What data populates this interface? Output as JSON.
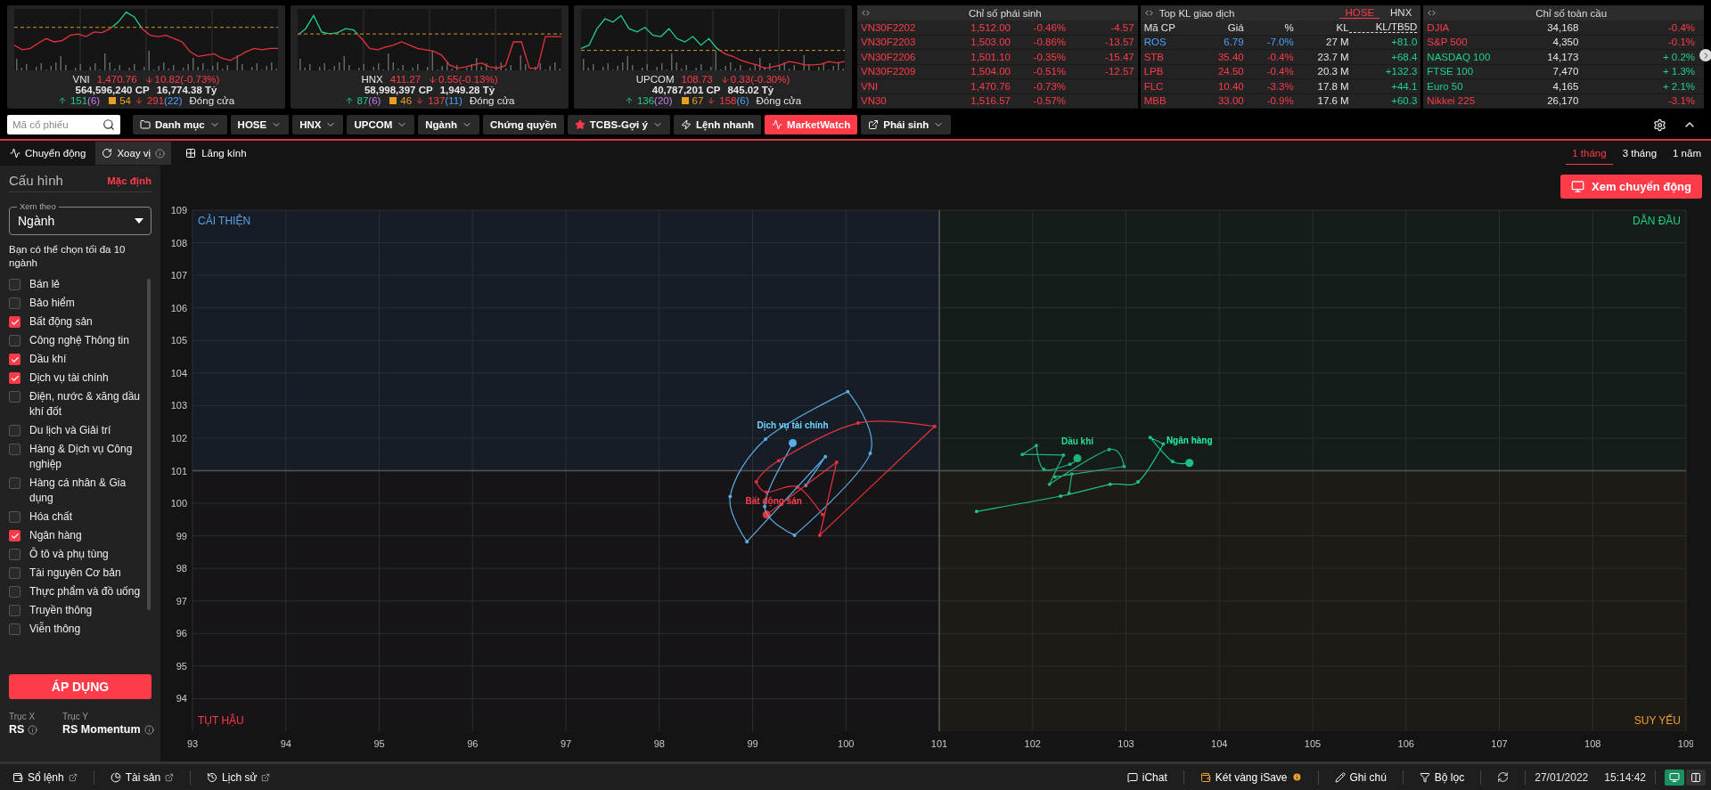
{
  "index_cards": [
    {
      "name": "VNI",
      "value": "1,470.76",
      "change": "10.82(-0.73%)",
      "volume": "564,596,240 CP",
      "turnover": "16,774.38 Tỷ",
      "advances": "151",
      "ceiling": "(6)",
      "unchanged": "54",
      "declines": "291",
      "floor": "(22)",
      "status": "Đóng cửa"
    },
    {
      "name": "HNX",
      "value": "411.27",
      "change": "0.55(-0.13%)",
      "volume": "58,998,397 CP",
      "turnover": "1,949.28 Tỷ",
      "advances": "87",
      "ceiling": "(6)",
      "unchanged": "46",
      "declines": "137",
      "floor": "(11)",
      "status": "Đóng cửa"
    },
    {
      "name": "UPCOM",
      "value": "108.73",
      "change": "0.33(-0.30%)",
      "volume": "40,787,201 CP",
      "turnover": "845.02 Tỷ",
      "advances": "136",
      "ceiling": "(20)",
      "unchanged": "67",
      "declines": "158",
      "floor": "(6)",
      "status": "Đóng cửa"
    }
  ],
  "derivatives": {
    "title": "Chỉ số phái sinh",
    "rows": [
      {
        "name": "VN30F2202",
        "price": "1,512.00",
        "pct": "-0.46%",
        "change": "-4.57"
      },
      {
        "name": "VN30F2203",
        "price": "1,503.00",
        "pct": "-0.86%",
        "change": "-13.57"
      },
      {
        "name": "VN30F2206",
        "price": "1,501.10",
        "pct": "-0.35%",
        "change": "-15.47"
      },
      {
        "name": "VN30F2209",
        "price": "1,504.00",
        "pct": "-0.51%",
        "change": "-12.57"
      },
      {
        "name": "VNI",
        "price": "1,470.76",
        "pct": "-0.73%"
      },
      {
        "name": "VN30",
        "price": "1,516.57",
        "pct": "-0.57%"
      }
    ]
  },
  "top_volume": {
    "title": "Top KL giao dịch",
    "tabs": [
      {
        "label": "HOSE",
        "selected": true
      },
      {
        "label": "HNX",
        "selected": false
      }
    ],
    "columns": [
      "Mã CP",
      "Giá",
      "%",
      "KL",
      "KL/TB5D"
    ],
    "rows": [
      {
        "code": "ROS",
        "price": "6.79",
        "pct": "-7.0%",
        "volume": "27 M",
        "ratio": "+81.0",
        "color": "#4aa3ff"
      },
      {
        "code": "STB",
        "price": "35.40",
        "pct": "-0.4%",
        "volume": "23.7 M",
        "ratio": "+68.4",
        "color": "#ff3b4a"
      },
      {
        "code": "LPB",
        "price": "24.50",
        "pct": "-0.4%",
        "volume": "20.3 M",
        "ratio": "+132.3",
        "color": "#ff3b4a"
      },
      {
        "code": "FLC",
        "price": "10.40",
        "pct": "-3.3%",
        "volume": "17.8 M",
        "ratio": "+44.1",
        "color": "#ff3b4a"
      },
      {
        "code": "MBB",
        "price": "33.00",
        "pct": "-0.9%",
        "volume": "17.6 M",
        "ratio": "+60.3",
        "color": "#ff3b4a"
      }
    ]
  },
  "global_indices": {
    "title": "Chỉ số toàn cầu",
    "rows": [
      {
        "name": "DJIA",
        "value": "34,168",
        "pct": "-0.4%",
        "color": "#ff3b4a"
      },
      {
        "name": "S&P 500",
        "value": "4,350",
        "pct": "-0.1%",
        "color": "#ff3b4a"
      },
      {
        "name": "NASDAQ 100",
        "value": "14,173",
        "pct": "+ 0.2%",
        "color": "#1fd18b"
      },
      {
        "name": "FTSE 100",
        "value": "7,470",
        "pct": "+ 1.3%",
        "color": "#1fd18b"
      },
      {
        "name": "Euro 50",
        "value": "4,165",
        "pct": "+ 2.1%",
        "color": "#1fd18b"
      },
      {
        "name": "Nikkei 225",
        "value": "26,170",
        "pct": "-3.1%",
        "color": "#ff3b4a"
      }
    ]
  },
  "toolbar": {
    "search": {
      "placeholder": "Mã cổ phiếu"
    },
    "items": [
      {
        "label": "Danh mục",
        "caret": true,
        "selected": false
      },
      {
        "label": "HOSE",
        "caret": true,
        "selected": false
      },
      {
        "label": "HNX",
        "caret": true,
        "selected": false
      },
      {
        "label": "UPCOM",
        "caret": true,
        "selected": false
      },
      {
        "label": "Ngành",
        "caret": true,
        "selected": false
      },
      {
        "label": "Chứng quyền",
        "caret": false,
        "selected": false
      },
      {
        "label": "TCBS-Gợi ý",
        "caret": true,
        "selected": false
      },
      {
        "label": "Lệnh nhanh",
        "caret": false,
        "selected": false
      },
      {
        "label": "MarketWatch",
        "caret": false,
        "selected": true
      },
      {
        "label": "Phái sinh",
        "caret": true,
        "selected": false
      }
    ]
  },
  "view_tabs": [
    {
      "label": "Chuyển động",
      "selected": false
    },
    {
      "label": "Xoay vị",
      "selected": true
    }
  ],
  "lens": "Lăng kính",
  "periods": [
    {
      "label": "1 tháng",
      "selected": true
    },
    {
      "label": "3 tháng",
      "selected": false
    },
    {
      "label": "1 năm",
      "selected": false
    }
  ],
  "sidebar": {
    "title": "Cấu hình",
    "reset": "Mặc định",
    "view_select": {
      "label": "Xem theo",
      "value": "Ngành"
    },
    "hint": "Bạn có thể chọn tối đa 10 ngành",
    "sectors": [
      {
        "label": "Bán lẻ",
        "checked": false
      },
      {
        "label": "Bảo hiểm",
        "checked": false
      },
      {
        "label": "Bất động sản",
        "checked": true
      },
      {
        "label": "Công nghệ Thông tin",
        "checked": false
      },
      {
        "label": "Dầu khí",
        "checked": true
      },
      {
        "label": "Dịch vụ tài chính",
        "checked": true
      },
      {
        "label": "Điện, nước & xăng dầu khí đốt",
        "checked": false
      },
      {
        "label": "Du lịch và Giải trí",
        "checked": false
      },
      {
        "label": "Hàng & Dịch vụ Công nghiệp",
        "checked": false
      },
      {
        "label": "Hàng cá nhân & Gia dụng",
        "checked": false
      },
      {
        "label": "Hóa chất",
        "checked": false
      },
      {
        "label": "Ngân hàng",
        "checked": true
      },
      {
        "label": "Ô tô và phụ tùng",
        "checked": false
      },
      {
        "label": "Tài nguyên Cơ bản",
        "checked": false
      },
      {
        "label": "Thực phẩm và đồ uống",
        "checked": false
      },
      {
        "label": "Truyền thông",
        "checked": false
      },
      {
        "label": "Viễn thông",
        "checked": false
      }
    ],
    "apply": "ÁP DỤNG",
    "axes": [
      {
        "label": "Trục X",
        "value": "RS"
      },
      {
        "label": "Trục Y",
        "value": "RS Momentum"
      }
    ]
  },
  "play_button": "Xem chuyển động",
  "rrg": {
    "chart_data": {
      "type": "line",
      "grid": true,
      "xlim": [
        93,
        109
      ],
      "ylim": [
        93,
        109
      ],
      "xticks": [
        93,
        94,
        95,
        96,
        97,
        98,
        99,
        100,
        101,
        102,
        103,
        104,
        105,
        106,
        107,
        108,
        109
      ],
      "yticks": [
        94,
        95,
        96,
        97,
        98,
        99,
        100,
        101,
        102,
        103,
        104,
        105,
        106,
        107,
        108,
        109
      ],
      "annotations": [
        "CẢI THIỆN",
        "DẪN ĐẦU",
        "TỤT HẬU",
        "SUY YẾU"
      ],
      "series": [
        {
          "name": "Dịch vụ tài chính",
          "color": "#5aaee8",
          "x": [
            99.57,
            99.78,
            98.94,
            98.76,
            99.14,
            100.02,
            100.26,
            99.45,
            99.13,
            99.43
          ],
          "values": [
            100.55,
            101.43,
            98.82,
            100.21,
            101.97,
            103.43,
            101.53,
            99.02,
            99.9,
            101.85
          ]
        },
        {
          "name": "Bất động sản",
          "color": "#e8323c",
          "x": [
            99.75,
            99.48,
            99.15,
            99.04,
            99.28,
            100.13,
            100.95,
            99.72,
            99.9,
            99.15
          ],
          "values": [
            99.65,
            100.5,
            100.34,
            100.66,
            101.31,
            102.46,
            102.36,
            99.02,
            101.26,
            99.65
          ]
        },
        {
          "name": "Dầu khí",
          "color": "#1fb37a",
          "x": [
            102.39,
            102.42,
            102.24,
            102.98,
            102.82,
            102.18,
            102.33,
            101.89,
            102.04,
            102.12,
            102.4,
            102.48
          ],
          "values": [
            100.31,
            100.9,
            100.81,
            101.13,
            101.65,
            100.58,
            101.48,
            101.5,
            101.77,
            101.04,
            101.2,
            101.38
          ]
        },
        {
          "name": "Ngân hàng",
          "color": "#19c486",
          "x": [
            101.4,
            102.3,
            102.83,
            103.13,
            103.4,
            103.26,
            103.5,
            103.68
          ],
          "values": [
            99.75,
            100.22,
            100.58,
            100.66,
            101.82,
            102.02,
            101.28,
            101.24
          ]
        }
      ]
    }
  },
  "bottom_bar": {
    "left": [
      {
        "label": "Sổ lệnh"
      },
      {
        "label": "Tài sản"
      },
      {
        "label": "Lịch sử"
      }
    ],
    "right": [
      {
        "label": "iChat"
      },
      {
        "label": "Két vàng iSave"
      },
      {
        "label": "Ghi chú"
      },
      {
        "label": "Bộ lọc"
      }
    ],
    "date": "27/01/2022",
    "time": "15:14:42",
    "layouts": [
      {
        "selected": true
      },
      {
        "selected": false
      }
    ]
  }
}
